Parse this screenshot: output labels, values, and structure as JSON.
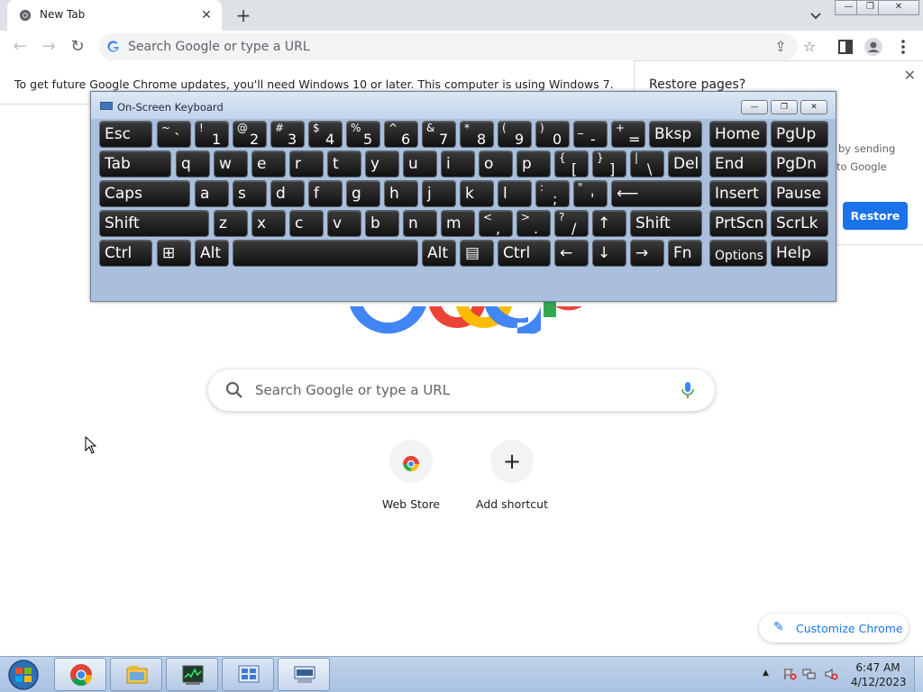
{
  "browser": {
    "tab": {
      "title": "New Tab",
      "close": "✕"
    },
    "new_tab": "+",
    "omnibox_placeholder": "Search Google or type a URL",
    "window_buttons": {
      "minimize": "—",
      "restore": "❐",
      "close": "✕"
    }
  },
  "infobar": {
    "message": "To get future Google Chrome updates, you'll need Windows 10 or later. This computer is using Windows 7."
  },
  "restore_bubble": {
    "title": "Restore pages?",
    "line1": "by sending",
    "line2": "to Google",
    "button": "Restore",
    "close": "✕"
  },
  "new_tab_page": {
    "search_placeholder": "Search Google or type a URL",
    "shortcuts": [
      {
        "label": "Web Store",
        "icon": "web-store-icon"
      },
      {
        "label": "Add shortcut",
        "icon": "plus-icon",
        "glyph": "+"
      }
    ],
    "customize_label": "Customize Chrome"
  },
  "osk": {
    "title": "On-Screen Keyboard",
    "rows": [
      [
        {
          "main": "Esc"
        },
        {
          "shift": "~",
          "low": "`"
        },
        {
          "shift": "!",
          "low": "1"
        },
        {
          "shift": "@",
          "low": "2"
        },
        {
          "shift": "#",
          "low": "3"
        },
        {
          "shift": "$",
          "low": "4"
        },
        {
          "shift": "%",
          "low": "5"
        },
        {
          "shift": "^",
          "low": "6"
        },
        {
          "shift": "&",
          "low": "7"
        },
        {
          "shift": "*",
          "low": "8"
        },
        {
          "shift": "(",
          "low": "9"
        },
        {
          "shift": ")",
          "low": "0"
        },
        {
          "shift": "_",
          "low": "-"
        },
        {
          "shift": "+",
          "low": "="
        },
        {
          "main": "Bksp"
        },
        {
          "main": "Home"
        },
        {
          "main": "PgUp"
        }
      ],
      [
        {
          "main": "Tab"
        },
        {
          "main": "q"
        },
        {
          "main": "w"
        },
        {
          "main": "e"
        },
        {
          "main": "r"
        },
        {
          "main": "t"
        },
        {
          "main": "y"
        },
        {
          "main": "u"
        },
        {
          "main": "i"
        },
        {
          "main": "o"
        },
        {
          "main": "p"
        },
        {
          "shift": "{",
          "low": "["
        },
        {
          "shift": "}",
          "low": "]"
        },
        {
          "shift": "|",
          "low": "\\"
        },
        {
          "main": "Del"
        },
        {
          "main": "End"
        },
        {
          "main": "PgDn"
        }
      ],
      [
        {
          "main": "Caps"
        },
        {
          "main": "a"
        },
        {
          "main": "s"
        },
        {
          "main": "d"
        },
        {
          "main": "f"
        },
        {
          "main": "g"
        },
        {
          "main": "h"
        },
        {
          "main": "j"
        },
        {
          "main": "k"
        },
        {
          "main": "l"
        },
        {
          "shift": ":",
          "low": ";"
        },
        {
          "shift": "\"",
          "low": "'"
        },
        {
          "main": "⟵"
        },
        {
          "main": "Insert"
        },
        {
          "main": "Pause"
        }
      ],
      [
        {
          "main": "Shift"
        },
        {
          "main": "z"
        },
        {
          "main": "x"
        },
        {
          "main": "c"
        },
        {
          "main": "v"
        },
        {
          "main": "b"
        },
        {
          "main": "n"
        },
        {
          "main": "m"
        },
        {
          "shift": "<",
          "low": ","
        },
        {
          "shift": ">",
          "low": "."
        },
        {
          "shift": "?",
          "low": "/"
        },
        {
          "main": "↑"
        },
        {
          "main": "Shift"
        },
        {
          "main": "PrtScn"
        },
        {
          "main": "ScrLk"
        }
      ],
      [
        {
          "main": "Ctrl"
        },
        {
          "main": "⊞"
        },
        {
          "main": "Alt"
        },
        {
          "main": ""
        },
        {
          "main": "Alt"
        },
        {
          "main": "▤"
        },
        {
          "main": "Ctrl"
        },
        {
          "main": "←"
        },
        {
          "main": "↓"
        },
        {
          "main": "→"
        },
        {
          "main": "Fn"
        },
        {
          "main": "Options"
        },
        {
          "main": "Help"
        }
      ]
    ]
  },
  "taskbar": {
    "apps": [
      "chrome-icon",
      "file-explorer-icon",
      "task-manager-icon",
      "control-panel-icon",
      "on-screen-keyboard-icon"
    ],
    "clock_time": "6:47 AM",
    "clock_date": "4/12/2023"
  }
}
